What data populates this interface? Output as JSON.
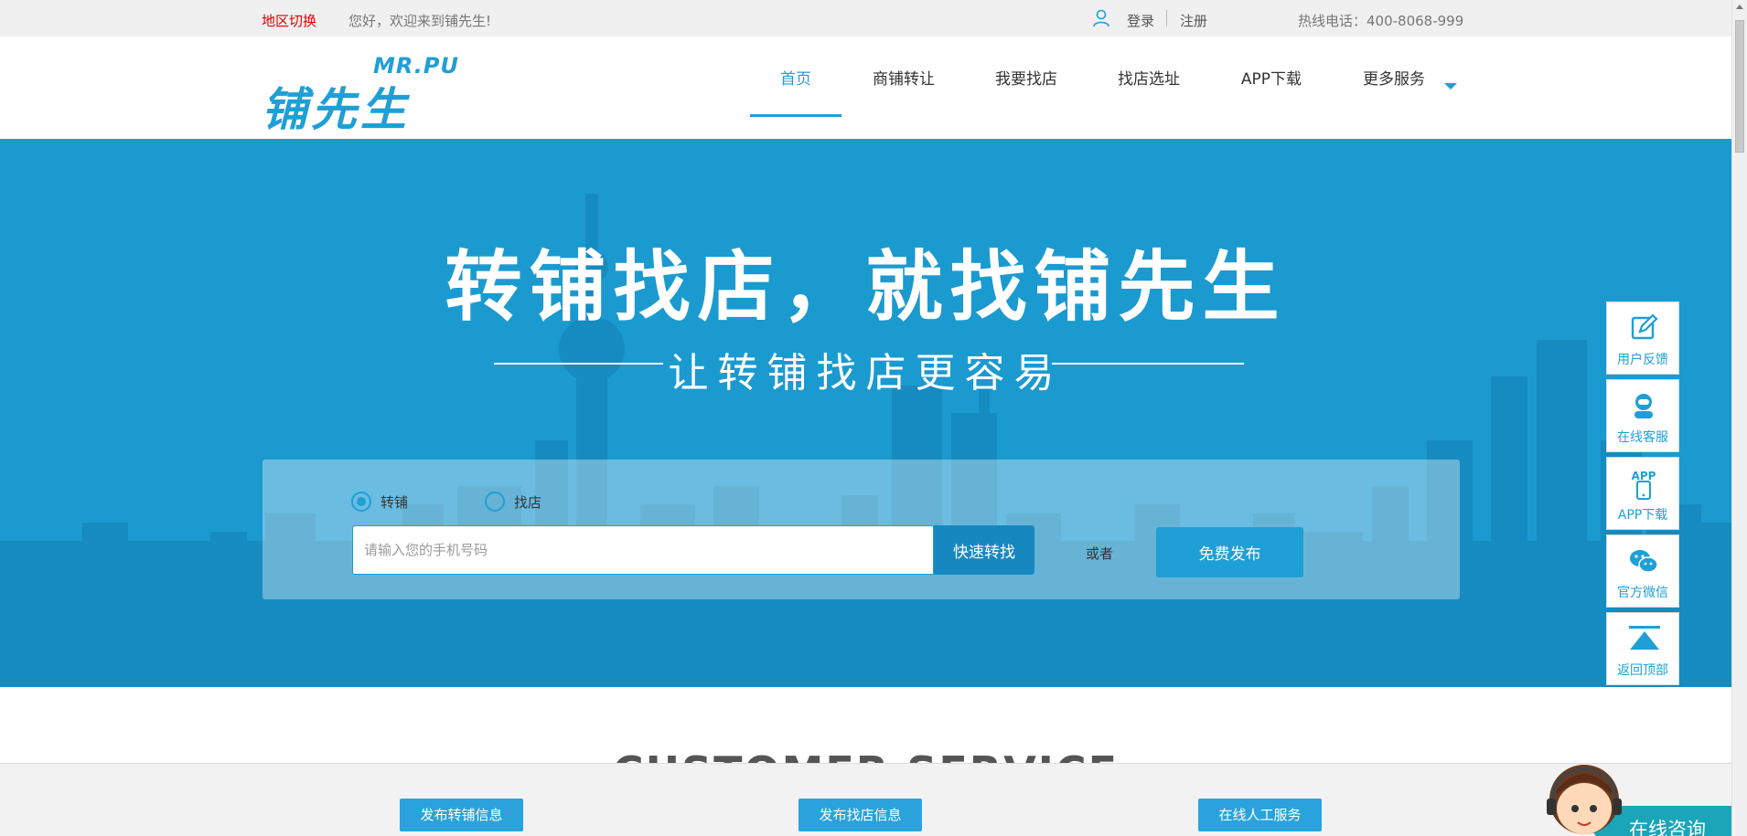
{
  "topbar": {
    "region_switch": "地区切换",
    "welcome": "您好，欢迎来到铺先生!",
    "login": "登录",
    "register": "注册",
    "hotline": "热线电话：400-8068-999"
  },
  "logo": {
    "en": "MR.PU",
    "cn": "铺先生"
  },
  "nav": {
    "items": [
      {
        "label": "首页",
        "active": true
      },
      {
        "label": "商铺转让"
      },
      {
        "label": "我要找店"
      },
      {
        "label": "找店选址"
      },
      {
        "label": "APP下载"
      },
      {
        "label": "更多服务",
        "dropdown": true
      }
    ]
  },
  "hero": {
    "title": "转铺找店，就找铺先生",
    "subtitle": "让转铺找店更容易"
  },
  "search": {
    "radio_transfer": "转铺",
    "radio_find": "找店",
    "selected": "转铺",
    "phone_placeholder": "请输入您的手机号码",
    "phone_value": "",
    "quick_button": "快速转找",
    "or": "或者",
    "publish_button": "免费发布"
  },
  "section": {
    "title": "CUSTOMER SERVICE"
  },
  "bottom_buttons": [
    "发布转铺信息",
    "发布找店信息",
    "在线人工服务"
  ],
  "side_tools": [
    {
      "label": "用户反馈",
      "icon": "edit-icon"
    },
    {
      "label": "在线客服",
      "icon": "customer-service-icon"
    },
    {
      "label": "APP下载",
      "icon": "phone-app-icon"
    },
    {
      "label": "官方微信",
      "icon": "wechat-icon"
    },
    {
      "label": "返回顶部",
      "icon": "back-to-top-icon"
    }
  ],
  "consult": {
    "label": "在线咨询"
  },
  "colors": {
    "brand": "#1f9fd6",
    "hero_bg": "#1b9ad0",
    "region": "#e00000"
  }
}
